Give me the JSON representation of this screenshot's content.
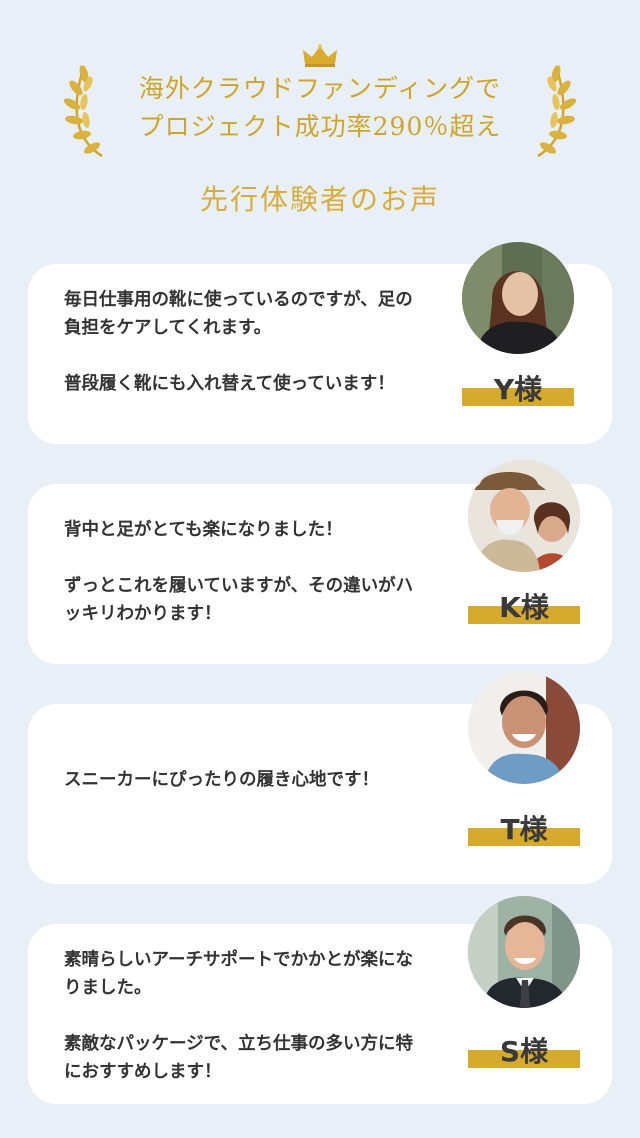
{
  "header": {
    "headline_line1": "海外クラウドファンディングで",
    "headline_line2": "プロジェクト成功率290％超え",
    "section_title": "先行体験者のお声"
  },
  "colors": {
    "accent_gold": "#d6aa2c",
    "background": "#e8eff7",
    "card": "#ffffff",
    "text": "#333333"
  },
  "testimonials": [
    {
      "text": "毎日仕事用の靴に使っているのですが、足の負担をケアしてくれます。\n\n普段履く靴にも入れ替えて使っています！",
      "name": "Y様",
      "avatar_icon": "woman-portrait-icon"
    },
    {
      "text": "背中と足がとても楽になりました！\n\nずっとこれを履いていますが、その違いがハッキリわかります！",
      "name": "K様",
      "avatar_icon": "couple-portrait-icon"
    },
    {
      "text": "スニーカーにぴったりの履き心地です！",
      "name": "T様",
      "avatar_icon": "man-portrait-icon"
    },
    {
      "text": "素晴らしいアーチサポートでかかとが楽になりました。\n\n素敵なパッケージで、立ち仕事の多い方に特におすすめします！",
      "name": "S様",
      "avatar_icon": "man-suit-portrait-icon"
    }
  ]
}
